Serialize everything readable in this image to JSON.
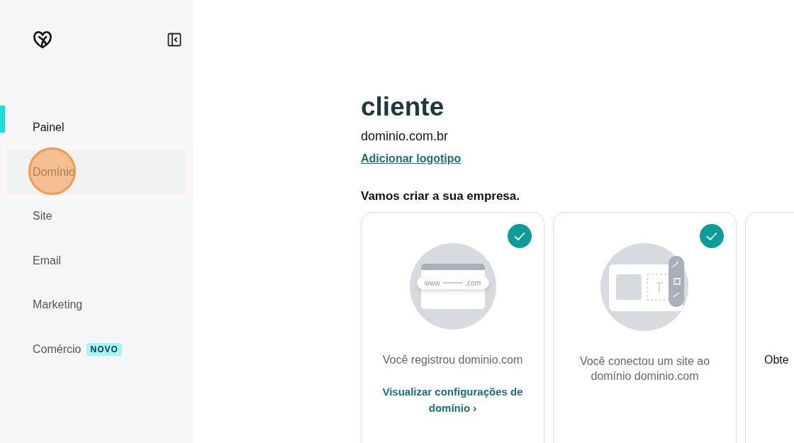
{
  "sidebar": {
    "items": [
      {
        "label": "Painel",
        "selected": true,
        "hovered": false
      },
      {
        "label": "Domínio",
        "selected": false,
        "hovered": true
      },
      {
        "label": "Site",
        "selected": false,
        "hovered": false
      },
      {
        "label": "Email",
        "selected": false,
        "hovered": false
      },
      {
        "label": "Marketing",
        "selected": false,
        "hovered": false
      },
      {
        "label": "Comércio",
        "selected": false,
        "hovered": false,
        "badge": "NOVO"
      }
    ]
  },
  "header": {
    "title": "cliente",
    "domain": "dominio.com.br",
    "link": "Adicionar logotipo"
  },
  "section": {
    "title": "Vamos criar a sua empresa.",
    "cards": [
      {
        "kind": "domain",
        "done": true,
        "lines": [
          "Você registrou dominio.com"
        ],
        "link": "Visualizar configurações de domínio",
        "link_arrow": "›",
        "url_prefix": "www",
        "url_suffix": ".com"
      },
      {
        "kind": "site",
        "done": true,
        "lines": [
          "Você conectou um site ao domínio dominio.com"
        ]
      },
      {
        "kind": "email",
        "lines": [
          "Obte"
        ]
      }
    ]
  }
}
